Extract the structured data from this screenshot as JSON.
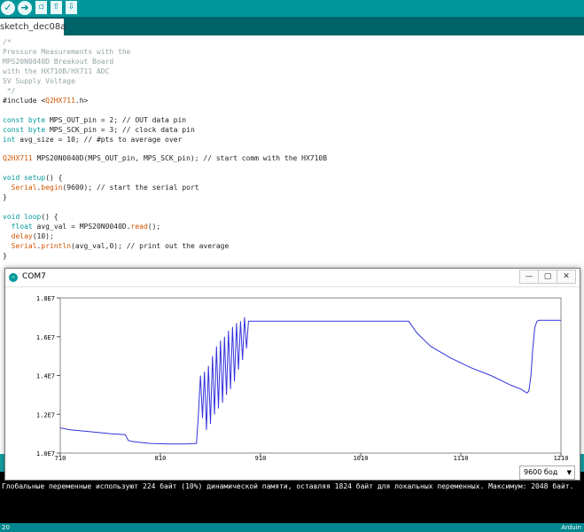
{
  "tab": {
    "label": "sketch_dec08a"
  },
  "code": [
    [
      {
        "t": "/*",
        "c": "cmt"
      }
    ],
    [
      {
        "t": "Pressure Measurements with the",
        "c": "cmt"
      }
    ],
    [
      {
        "t": "MPS20N0040D Breakout Board",
        "c": "cmt"
      }
    ],
    [
      {
        "t": "with the HX710B/HX711 ADC",
        "c": "cmt"
      }
    ],
    [
      {
        "t": "5V Supply Voltage",
        "c": "cmt"
      }
    ],
    [
      {
        "t": " */",
        "c": "cmt"
      }
    ],
    [
      {
        "t": "#include <",
        "c": ""
      },
      {
        "t": "Q2HX711",
        "c": "fn"
      },
      {
        "t": ".h>",
        "c": ""
      }
    ],
    [],
    [
      {
        "t": "const byte",
        "c": "kw"
      },
      {
        "t": " MPS_OUT_pin = 2; ",
        "c": ""
      },
      {
        "t": "// OUT data pin",
        "c": ""
      }
    ],
    [
      {
        "t": "const byte",
        "c": "kw"
      },
      {
        "t": " MPS_SCK_pin = 3; ",
        "c": ""
      },
      {
        "t": "// clock data pin",
        "c": ""
      }
    ],
    [
      {
        "t": "int",
        "c": "kw"
      },
      {
        "t": " avg_size = 10; ",
        "c": ""
      },
      {
        "t": "// #pts to average over",
        "c": ""
      }
    ],
    [],
    [
      {
        "t": "Q2HX711",
        "c": "fn"
      },
      {
        "t": " MPS20N0040D(MPS_OUT_pin, MPS_SCK_pin); ",
        "c": ""
      },
      {
        "t": "// start comm with the HX710B",
        "c": ""
      }
    ],
    [],
    [
      {
        "t": "void",
        "c": "kw"
      },
      {
        "t": " ",
        "c": ""
      },
      {
        "t": "setup",
        "c": "kw"
      },
      {
        "t": "() {",
        "c": ""
      }
    ],
    [
      {
        "t": "  ",
        "c": ""
      },
      {
        "t": "Serial",
        "c": "fn"
      },
      {
        "t": ".",
        "c": ""
      },
      {
        "t": "begin",
        "c": "fn"
      },
      {
        "t": "(9600); ",
        "c": ""
      },
      {
        "t": "// start the serial port",
        "c": ""
      }
    ],
    [
      {
        "t": "}",
        "c": ""
      }
    ],
    [],
    [
      {
        "t": "void",
        "c": "kw"
      },
      {
        "t": " ",
        "c": ""
      },
      {
        "t": "loop",
        "c": "kw"
      },
      {
        "t": "() {",
        "c": ""
      }
    ],
    [
      {
        "t": "  ",
        "c": ""
      },
      {
        "t": "float",
        "c": "kw"
      },
      {
        "t": " avg_val = MPS20N0040D.",
        "c": ""
      },
      {
        "t": "read",
        "c": "fn"
      },
      {
        "t": "();",
        "c": ""
      }
    ],
    [
      {
        "t": "  ",
        "c": ""
      },
      {
        "t": "delay",
        "c": "fn"
      },
      {
        "t": "(10);",
        "c": ""
      }
    ],
    [
      {
        "t": "  ",
        "c": ""
      },
      {
        "t": "Serial",
        "c": "fn"
      },
      {
        "t": ".",
        "c": ""
      },
      {
        "t": "println",
        "c": "fn"
      },
      {
        "t": "(avg_val,0); ",
        "c": ""
      },
      {
        "t": "// print out the average",
        "c": ""
      }
    ],
    [
      {
        "t": "}",
        "c": ""
      }
    ]
  ],
  "serial_window": {
    "title": "COM7",
    "minimize": "—",
    "maximize": "▢",
    "close": "✕",
    "baud": "9600 бод"
  },
  "console": {
    "message": "Глобальные переменные используют 224 байт (10%) динамической памяти, оставляя 1824 байт для локальных переменных. Максимум: 2048 байт."
  },
  "status": {
    "line": "20",
    "board": "Arduin"
  },
  "colors": {
    "teal": "#00979c",
    "trace": "#3333dd"
  },
  "chart_data": {
    "type": "line",
    "x_ticks": [
      "710",
      "810",
      "910",
      "1010",
      "1110",
      "1210"
    ],
    "y_ticks": [
      "1.0E7",
      "1.2E7",
      "1.4E7",
      "1.6E7",
      "1.8E7"
    ],
    "xlim": [
      710,
      1210
    ],
    "ylim": [
      10000000,
      18000000
    ],
    "series": [
      {
        "x": [
          710,
          720,
          740,
          760,
          775,
          778,
          782,
          790,
          800,
          812,
          820,
          833,
          840,
          846,
          848,
          850,
          852,
          854,
          856,
          858,
          860,
          862,
          864,
          866,
          868,
          870,
          872,
          874,
          876,
          878,
          880,
          882,
          884,
          886,
          888,
          890,
          892,
          894,
          896,
          898,
          900,
          905,
          920,
          960,
          1000,
          1040,
          1058,
          1066,
          1080,
          1100,
          1120,
          1140,
          1160,
          1170,
          1176,
          1178,
          1180,
          1182,
          1184,
          1186,
          1188,
          1190,
          1210
        ],
        "y": [
          11300000,
          11200000,
          11100000,
          11000000,
          10950000,
          10650000,
          10600000,
          10550000,
          10500000,
          10480000,
          10470000,
          10470000,
          10480000,
          10500000,
          12000000,
          14000000,
          11800000,
          14200000,
          11200000,
          14500000,
          11500000,
          15000000,
          12000000,
          15500000,
          12300000,
          15800000,
          12600000,
          16000000,
          13000000,
          16300000,
          13300000,
          16500000,
          13700000,
          16700000,
          14300000,
          16800000,
          14800000,
          17000000,
          15400000,
          16800000,
          16800000,
          16800000,
          16800000,
          16800000,
          16800000,
          16800000,
          16800000,
          16200000,
          15500000,
          14900000,
          14400000,
          14000000,
          13500000,
          13300000,
          13100000,
          13200000,
          14000000,
          15500000,
          16500000,
          16800000,
          16850000,
          16850000,
          16850000
        ]
      }
    ]
  }
}
